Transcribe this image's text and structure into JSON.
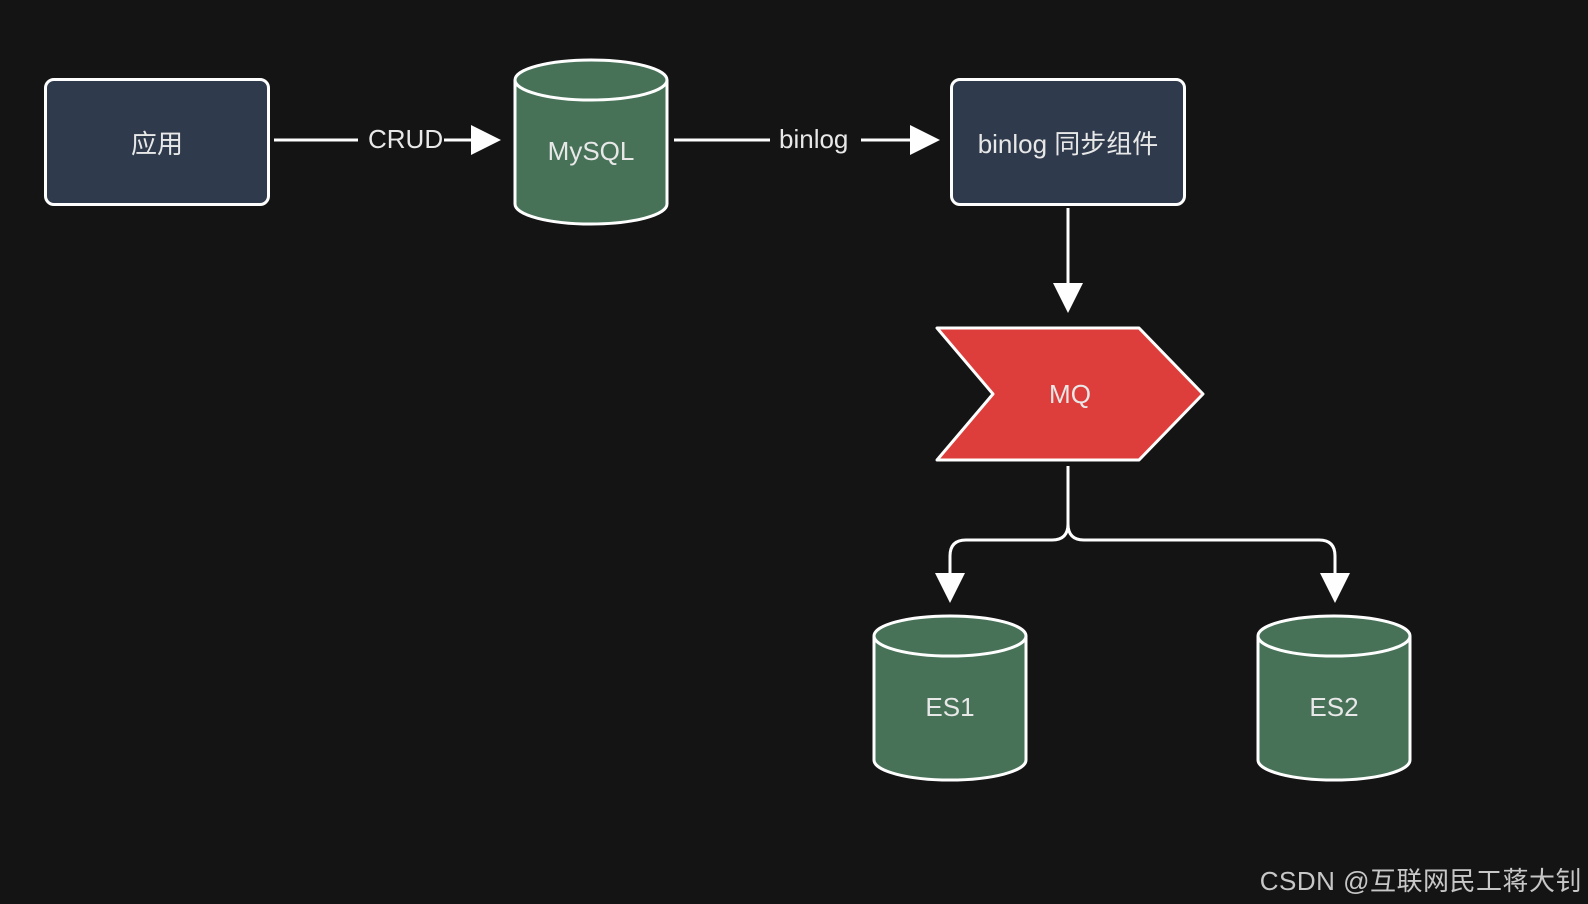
{
  "nodes": {
    "app": {
      "label": "应用"
    },
    "mysql": {
      "label": "MySQL"
    },
    "binlog_sync": {
      "label": "binlog 同步组件"
    },
    "mq": {
      "label": "MQ"
    },
    "es1": {
      "label": "ES1"
    },
    "es2": {
      "label": "ES2"
    }
  },
  "edges": {
    "crud": {
      "label": "CRUD"
    },
    "binlog": {
      "label": "binlog"
    }
  },
  "watermark": "CSDN @互联网民工蒋大钊"
}
